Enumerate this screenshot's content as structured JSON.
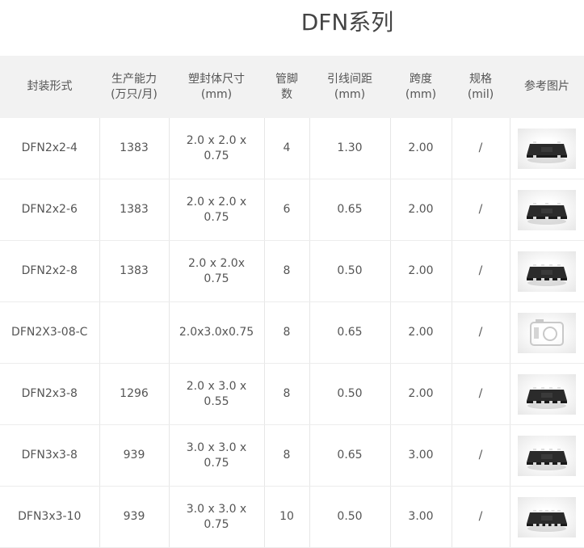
{
  "title": "DFN系列",
  "table": {
    "headers": [
      [
        "封装形式"
      ],
      [
        "生产能力",
        "(万只/月)"
      ],
      [
        "塑封体尺寸",
        "(mm)"
      ],
      [
        "管脚",
        "数"
      ],
      [
        "引线间距",
        "(mm)"
      ],
      [
        "跨度",
        "(mm)"
      ],
      [
        "规格",
        "(mil)"
      ],
      [
        "参考图片"
      ]
    ],
    "rows": [
      {
        "pkg": "DFN2x2-4",
        "cap": "1383",
        "size": [
          "2.0 x 2.0 x",
          "0.75"
        ],
        "pins": "4",
        "pitch": "1.30",
        "span": "2.00",
        "spec": "/",
        "img": "chip-4-icon"
      },
      {
        "pkg": "DFN2x2-6",
        "cap": "1383",
        "size": [
          "2.0 x 2.0 x",
          "0.75"
        ],
        "pins": "6",
        "pitch": "0.65",
        "span": "2.00",
        "spec": "/",
        "img": "chip-6-icon"
      },
      {
        "pkg": "DFN2x2-8",
        "cap": "1383",
        "size": [
          "2.0 x 2.0x",
          "0.75"
        ],
        "pins": "8",
        "pitch": "0.50",
        "span": "2.00",
        "spec": "/",
        "img": "chip-8-icon"
      },
      {
        "pkg": "DFN2X3-08-C",
        "cap": "",
        "size": [
          "2.0x3.0x0.75",
          ""
        ],
        "pins": "8",
        "pitch": "0.65",
        "span": "2.00",
        "spec": "/",
        "img": "camera-placeholder-icon"
      },
      {
        "pkg": "DFN2x3-8",
        "cap": "1296",
        "size": [
          "2.0 x 3.0 x",
          "0.55"
        ],
        "pins": "8",
        "pitch": "0.50",
        "span": "2.00",
        "spec": "/",
        "img": "chip-8-icon"
      },
      {
        "pkg": "DFN3x3-8",
        "cap": "939",
        "size": [
          "3.0 x 3.0 x",
          "0.75"
        ],
        "pins": "8",
        "pitch": "0.65",
        "span": "3.00",
        "spec": "/",
        "img": "chip-8-icon"
      },
      {
        "pkg": "DFN3x3-10",
        "cap": "939",
        "size": [
          "3.0 x 3.0 x",
          "0.75"
        ],
        "pins": "10",
        "pitch": "0.50",
        "span": "3.00",
        "spec": "/",
        "img": "chip-10-icon"
      }
    ]
  },
  "colors": {
    "header_bg": "#f2f2f2",
    "chip_body": "#2b2b2b",
    "chip_pad": "#d8d8d8"
  }
}
